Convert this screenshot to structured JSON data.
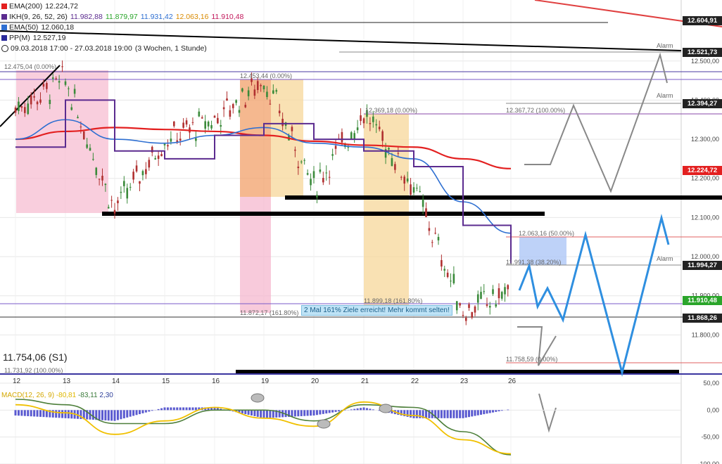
{
  "legend": {
    "ema200": {
      "label": "EMA(200)",
      "value": "12.224,72",
      "color": "#e32020"
    },
    "ikh": {
      "label": "IKH(9, 26, 52, 26)",
      "v1": "11.982,88",
      "v2": "11.879,97",
      "v3": "11.931,42",
      "v4": "12.063,16",
      "v5": "11.910,48",
      "color": "#5b2b8f"
    },
    "ema50": {
      "label": "EMA(50)",
      "value": "12.060,18",
      "color": "#2e6fd1"
    },
    "pp": {
      "label": "PP(M)",
      "value": "12.527,19",
      "color": "#2a2a9a"
    },
    "period": "09.03.2018 17:00 - 27.03.2018 19:00",
    "period_note": "(3 Wochen, 1 Stunde)"
  },
  "price_tags": [
    {
      "value": "12.604,91",
      "bg": "#222222"
    },
    {
      "value": "12.521,73",
      "bg": "#222222"
    },
    {
      "value": "12.394,27",
      "bg": "#222222"
    },
    {
      "value": "12.224,72",
      "bg": "#e32020"
    },
    {
      "value": "11.994,27",
      "bg": "#222222"
    },
    {
      "value": "11.910,48",
      "bg": "#2aa52a"
    },
    {
      "value": "11.868,26",
      "bg": "#222222"
    }
  ],
  "alarm_label": "Alarm",
  "annotations": {
    "a1": "12.475,04 (0.00%)",
    "a2": "12.453,44 (0.00%)",
    "a3": "12.369,18 (0.00%)",
    "a4": "12.367,72 (100.00%)",
    "a5": "12.063,16 (50.00%)",
    "a6": "11.991,38 (38.20%)",
    "a7": "11.899,18 (161.80%)",
    "a8": "11.872,17 (161.80%)",
    "a9": "11.758,59 (0.00%)",
    "a10": "11.731,92 (100.00%)"
  },
  "banner": "2 Mal 161% Ziele erreicht! Mehr kommt selten!",
  "s1_label": "11.754,06 (S1)",
  "dates": [
    "12",
    "13",
    "14",
    "15",
    "16",
    "19",
    "20",
    "21",
    "22",
    "23",
    "26"
  ],
  "macd": {
    "label": "MACD(12, 26, 9)",
    "v1": "-80,81",
    "v2": "-83,11",
    "v3": "2,30"
  },
  "chart_data": {
    "type": "line",
    "title": "",
    "xlabel": "",
    "ylabel": "",
    "x": [
      "12",
      "13",
      "14",
      "15",
      "16",
      "19",
      "20",
      "21",
      "22",
      "23",
      "26"
    ],
    "ylim": [
      11700,
      12620
    ],
    "y_ticks": [
      "12.500,00",
      "12.400,00",
      "12.300,00",
      "12.200,00",
      "12.100,00",
      "12.000,00",
      "11.900,00",
      "11.800,00"
    ],
    "y_tick_values": [
      12500,
      12400,
      12300,
      12200,
      12100,
      12000,
      11900,
      11800
    ],
    "grid": true,
    "series": [
      {
        "name": "EMA(200)",
        "color": "#e32020",
        "values": [
          12300,
          12320,
          12330,
          12325,
          12320,
          12310,
          12295,
          12285,
          12280,
          12250,
          12225
        ]
      },
      {
        "name": "EMA(50)",
        "color": "#2e6fd1",
        "values": [
          12300,
          12350,
          12300,
          12290,
          12310,
          12330,
          12290,
          12280,
          12250,
          12140,
          12060
        ]
      },
      {
        "name": "IKH(9, 26, 52, 26)",
        "color": "#5b2b8f",
        "values": [
          12280,
          12400,
          12270,
          12250,
          12310,
          12340,
          12300,
          12270,
          12230,
          12080,
          11983
        ]
      },
      {
        "name": "Kurs",
        "color": "#555555",
        "values": [
          12380,
          12450,
          12120,
          12300,
          12350,
          12453,
          12180,
          12369,
          12180,
          11860,
          11910
        ]
      }
    ],
    "levels": [
      12604.91,
      12521.73,
      12394.27,
      12224.72,
      11994.27,
      11910.48,
      11868.26
    ],
    "macd": {
      "ylim": [
        -100,
        50
      ],
      "y_ticks": [
        "50,00",
        "0,00",
        "-50,00",
        "-100,00"
      ],
      "y_tick_values": [
        50,
        0,
        -50,
        -100
      ],
      "macd_values": [
        10,
        -5,
        -45,
        -20,
        5,
        -15,
        -30,
        15,
        -10,
        -55,
        -81
      ],
      "signal_values": [
        20,
        10,
        -25,
        -25,
        0,
        0,
        -20,
        10,
        5,
        -40,
        -83
      ],
      "histogram": [
        -10,
        -15,
        -20,
        5,
        5,
        -15,
        -10,
        5,
        -15,
        -15,
        2
      ]
    }
  }
}
